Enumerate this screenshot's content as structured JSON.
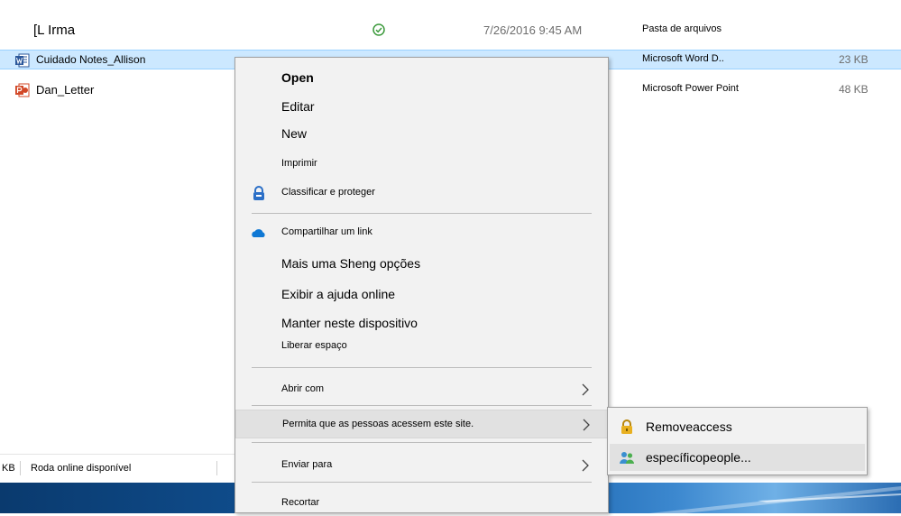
{
  "files": [
    {
      "name": "[L Irma",
      "status": "ok",
      "date": "7/26/2016 9:45 AM",
      "type": "Pasta de arquivos",
      "size": "",
      "icon": "folder-icon"
    },
    {
      "name": "Cuidado Notes_Allison",
      "status": "",
      "date": "",
      "type": "Microsoft Word D..",
      "size": "23 KB",
      "icon": "word-doc-icon"
    },
    {
      "name": "Dan_Letter",
      "status": "",
      "date": "",
      "type": "Microsoft Power Point",
      "size": "48 KB",
      "icon": "powerpoint-icon"
    }
  ],
  "status_bar": {
    "size_fragment": "KB",
    "availability": "Roda online disponível"
  },
  "context_menu": {
    "open": "Open",
    "edit": "Editar",
    "new": "New",
    "print": "Imprimir",
    "classify": "Classificar e proteger",
    "share_link": "Compartilhar um link",
    "more_options": "Mais uma Sheng opções",
    "help_online": "Exibir a ajuda online",
    "keep_on_device": "Manter neste dispositivo",
    "free_space": "Liberar espaço",
    "open_with": "Abrir com",
    "allow_access": "Permita que as pessoas acessem este site.",
    "send_to": "Enviar para",
    "cut": "Recortar"
  },
  "submenu": {
    "remove_access": "Removeaccess",
    "specific_people": "específicopeople..."
  },
  "colors": {
    "selection": "#cce8ff",
    "menu_bg": "#f2f2f2",
    "menu_highlight": "#e1e1e1",
    "ok_green": "#3c9a3c",
    "word_blue": "#2b579a",
    "ppt_red": "#d24726",
    "onedrive_blue": "#0f78d4"
  }
}
